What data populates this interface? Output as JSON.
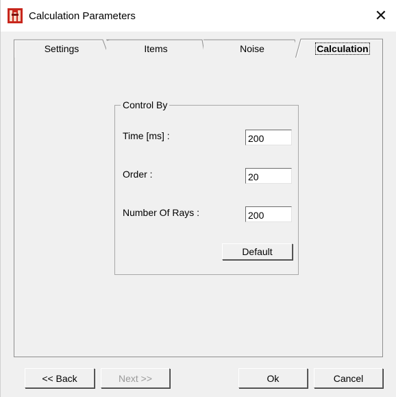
{
  "window": {
    "title": "Calculation Parameters",
    "close_glyph": "✕",
    "app_icon": "app-icon"
  },
  "tabs": [
    {
      "label": "Settings",
      "active": false
    },
    {
      "label": "Items",
      "active": false
    },
    {
      "label": "Noise",
      "active": false
    },
    {
      "label": "Calculation",
      "active": true
    }
  ],
  "group": {
    "label": "Control By",
    "fields": [
      {
        "label": "Time [ms] :",
        "value": "200"
      },
      {
        "label": "Order :",
        "value": "20"
      },
      {
        "label": "Number Of Rays :",
        "value": "200"
      }
    ],
    "default_label": "Default"
  },
  "footer": {
    "back_label": "<< Back",
    "next_label": "Next >>",
    "ok_label": "Ok",
    "cancel_label": "Cancel",
    "next_enabled": false
  },
  "colors": {
    "background": "#f0f0f0",
    "titlebar": "#ffffff",
    "icon_red": "#c8261c",
    "border": "#8e8e8e"
  }
}
